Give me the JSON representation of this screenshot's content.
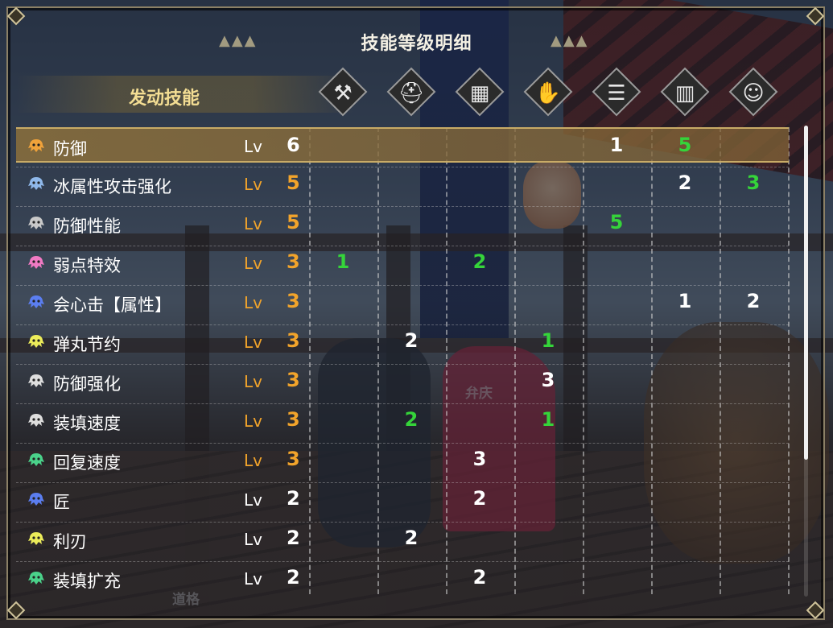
{
  "title": "技能等级明细",
  "column_header": "发动技能",
  "lv_label": "Lv",
  "scene_labels": {
    "npc": "弁庆",
    "bottom": "道格"
  },
  "colors": {
    "orange_level": "#f2a42b",
    "green_value": "#35d43a",
    "header_gold": "#f3dd93"
  },
  "equipment_columns": [
    {
      "icon": "weapon-icon"
    },
    {
      "icon": "helmet-icon"
    },
    {
      "icon": "chest-armor-icon"
    },
    {
      "icon": "arm-armor-icon"
    },
    {
      "icon": "waist-armor-icon"
    },
    {
      "icon": "leg-armor-icon"
    },
    {
      "icon": "talisman-icon"
    }
  ],
  "skills": [
    {
      "name": "防御",
      "level": "6",
      "level_color": "white",
      "icon_color": "#f0a23a",
      "values": [
        "",
        "",
        "",
        "",
        "1",
        "5",
        ""
      ],
      "value_colors": [
        "",
        "",
        "",
        "",
        "white",
        "green",
        ""
      ],
      "selected": true
    },
    {
      "name": "冰属性攻击强化",
      "level": "5",
      "level_color": "orange",
      "icon_color": "#8fb8ea",
      "values": [
        "",
        "",
        "",
        "",
        "",
        "2",
        "3"
      ],
      "value_colors": [
        "",
        "",
        "",
        "",
        "",
        "white",
        "green"
      ]
    },
    {
      "name": "防御性能",
      "level": "5",
      "level_color": "orange",
      "icon_color": "#c9c9c9",
      "values": [
        "",
        "",
        "",
        "",
        "5",
        "",
        ""
      ],
      "value_colors": [
        "",
        "",
        "",
        "",
        "green",
        "",
        ""
      ]
    },
    {
      "name": "弱点特效",
      "level": "3",
      "level_color": "orange",
      "icon_color": "#f07ac3",
      "values": [
        "1",
        "",
        "2",
        "",
        "",
        "",
        ""
      ],
      "value_colors": [
        "green",
        "",
        "green",
        "",
        "",
        "",
        ""
      ]
    },
    {
      "name": "会心击【属性】",
      "level": "3",
      "level_color": "orange",
      "icon_color": "#5b7ef0",
      "values": [
        "",
        "",
        "",
        "",
        "",
        "1",
        "2"
      ],
      "value_colors": [
        "",
        "",
        "",
        "",
        "",
        "white",
        "white"
      ]
    },
    {
      "name": "弹丸节约",
      "level": "3",
      "level_color": "orange",
      "icon_color": "#ecec5a",
      "values": [
        "",
        "2",
        "",
        "1",
        "",
        "",
        ""
      ],
      "value_colors": [
        "",
        "white",
        "",
        "green",
        "",
        "",
        ""
      ]
    },
    {
      "name": "防御强化",
      "level": "3",
      "level_color": "orange",
      "icon_color": "#dedede",
      "values": [
        "",
        "",
        "",
        "3",
        "",
        "",
        ""
      ],
      "value_colors": [
        "",
        "",
        "",
        "white",
        "",
        "",
        ""
      ]
    },
    {
      "name": "装填速度",
      "level": "3",
      "level_color": "orange",
      "icon_color": "#dedede",
      "values": [
        "",
        "2",
        "",
        "1",
        "",
        "",
        ""
      ],
      "value_colors": [
        "",
        "green",
        "",
        "green",
        "",
        "",
        ""
      ]
    },
    {
      "name": "回复速度",
      "level": "3",
      "level_color": "orange",
      "icon_color": "#4ad28a",
      "values": [
        "",
        "",
        "3",
        "",
        "",
        "",
        ""
      ],
      "value_colors": [
        "",
        "",
        "white",
        "",
        "",
        "",
        ""
      ]
    },
    {
      "name": "匠",
      "level": "2",
      "level_color": "white",
      "icon_color": "#5b7ef0",
      "values": [
        "",
        "",
        "2",
        "",
        "",
        "",
        ""
      ],
      "value_colors": [
        "",
        "",
        "white",
        "",
        "",
        "",
        ""
      ]
    },
    {
      "name": "利刃",
      "level": "2",
      "level_color": "white",
      "icon_color": "#ecec5a",
      "values": [
        "",
        "2",
        "",
        "",
        "",
        "",
        ""
      ],
      "value_colors": [
        "",
        "white",
        "",
        "",
        "",
        "",
        ""
      ]
    },
    {
      "name": "装填扩充",
      "level": "2",
      "level_color": "white",
      "icon_color": "#4ad28a",
      "values": [
        "",
        "",
        "2",
        "",
        "",
        "",
        ""
      ],
      "value_colors": [
        "",
        "",
        "white",
        "",
        "",
        "",
        ""
      ]
    }
  ]
}
